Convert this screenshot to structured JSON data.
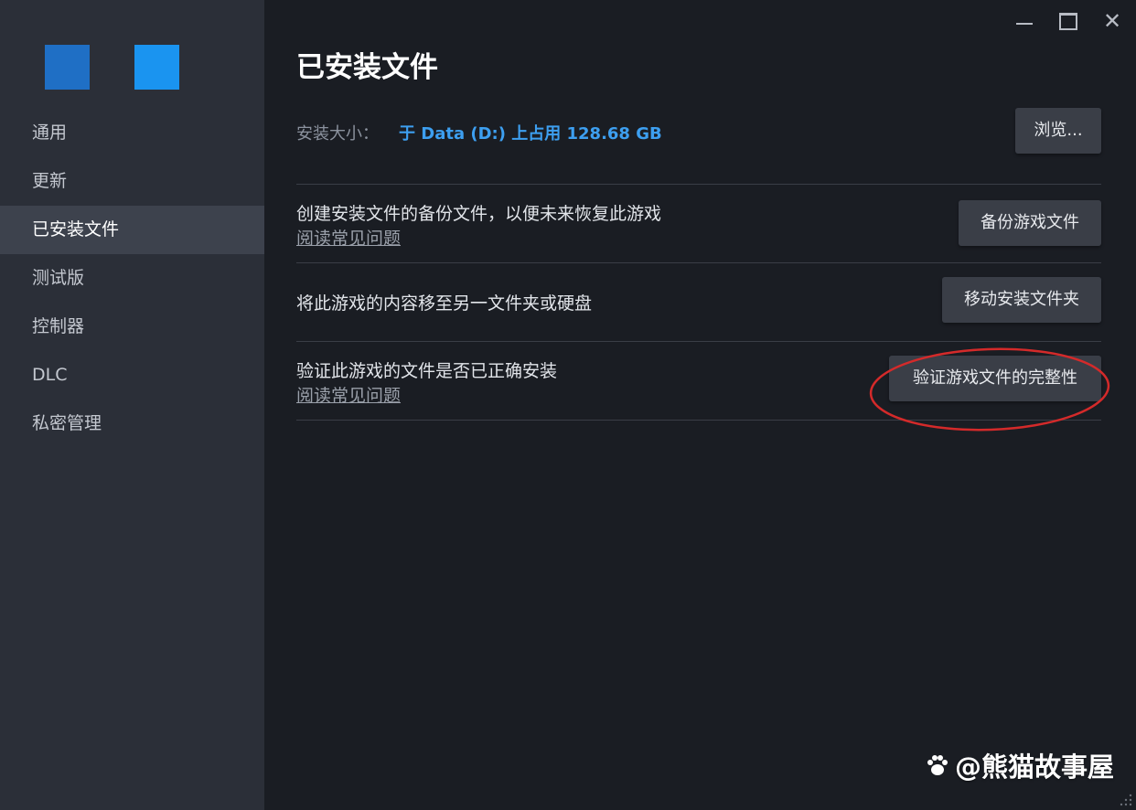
{
  "sidebar": {
    "items": [
      {
        "label": "通用"
      },
      {
        "label": "更新"
      },
      {
        "label": "已安装文件"
      },
      {
        "label": "测试版"
      },
      {
        "label": "控制器"
      },
      {
        "label": "DLC"
      },
      {
        "label": "私密管理"
      }
    ],
    "active_index": 2
  },
  "header": {
    "title": "已安装文件"
  },
  "install_size": {
    "label": "安装大小：",
    "value": "于 Data (D:) 上占用 128.68 GB",
    "browse_label": "浏览..."
  },
  "sections": {
    "backup": {
      "text": "创建安装文件的备份文件，以便未来恢复此游戏",
      "faq": "阅读常见问题",
      "button": "备份游戏文件"
    },
    "move": {
      "text": "将此游戏的内容移至另一文件夹或硬盘",
      "button": "移动安装文件夹"
    },
    "verify": {
      "text": "验证此游戏的文件是否已正确安装",
      "faq": "阅读常见问题",
      "button": "验证游戏文件的完整性"
    }
  },
  "watermark": {
    "text": "@熊猫故事屋"
  },
  "colors": {
    "accent_blue": "#3d9ff0",
    "logo_left": "#1f6fc5",
    "logo_right": "#1a94f0",
    "annotation_red": "#d42a2a",
    "sidebar_bg": "#2b2f38",
    "main_bg": "#1a1d23"
  },
  "icons": {
    "minimize": "minimize-icon",
    "maximize": "maximize-icon",
    "close": "close-icon",
    "paw": "paw-icon"
  }
}
